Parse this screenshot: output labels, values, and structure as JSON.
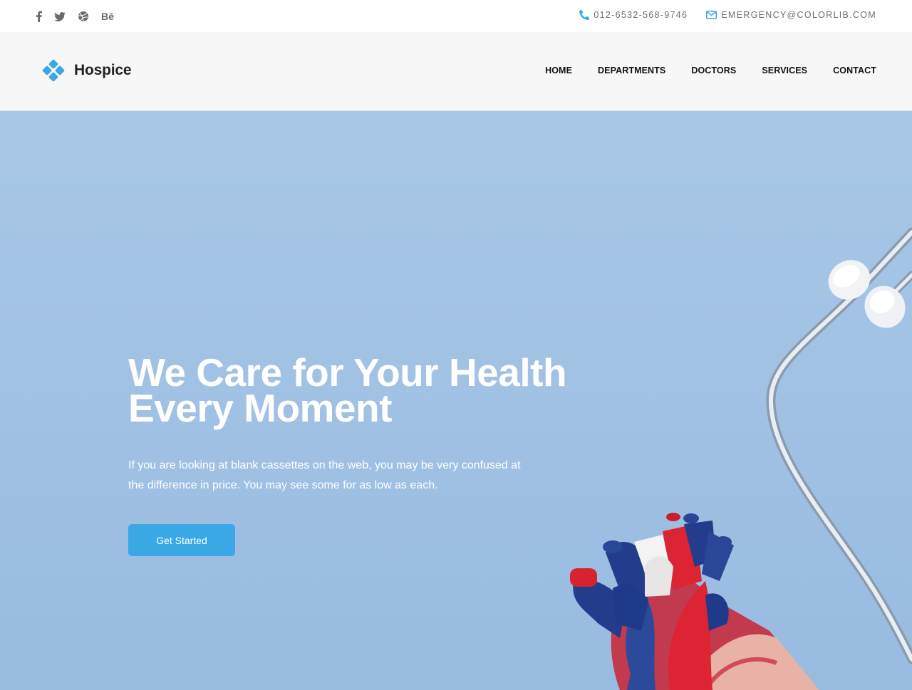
{
  "topbar": {
    "social": [
      {
        "icon": "facebook-icon"
      },
      {
        "icon": "twitter-icon"
      },
      {
        "icon": "dribbble-icon"
      },
      {
        "icon": "behance-icon",
        "label": "Bē"
      }
    ],
    "phone": {
      "icon": "phone-icon",
      "text": "012-6532-568-9746"
    },
    "email": {
      "icon": "envelope-icon",
      "text": "EMERGENCY@COLORLIB.COM"
    }
  },
  "header": {
    "logo_text": "Hospice",
    "nav": [
      "HOME",
      "DEPARTMENTS",
      "DOCTORS",
      "SERVICES",
      "CONTACT"
    ]
  },
  "hero": {
    "title_line1": "We Care for Your Health",
    "title_line2": "Every Moment",
    "text_line1": "If you are looking at blank cassettes on the web, you may be very confused at",
    "text_line2": "the difference in price. You may see some for as low as each.",
    "button": "Get Started"
  },
  "colors": {
    "accent": "#39a8e4",
    "hero_bg": "#a2c2e4",
    "header_bg": "#f7f7f7",
    "nav_text": "#111111"
  }
}
